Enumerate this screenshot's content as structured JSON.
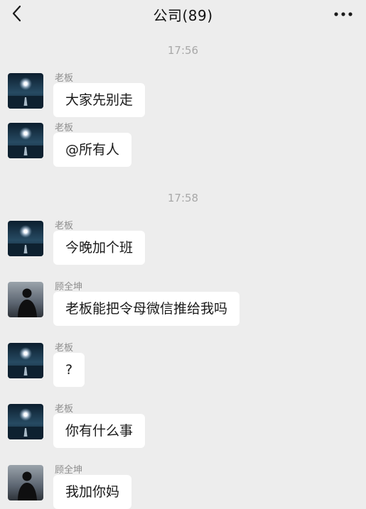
{
  "header": {
    "title": "公司(89)"
  },
  "timestamps": [
    "17:56",
    "17:58"
  ],
  "messages": [
    {
      "sender": "老板",
      "text": "大家先别走"
    },
    {
      "sender": "老板",
      "text": "@所有人"
    },
    {
      "sender": "老板",
      "text": "今晚加个班"
    },
    {
      "sender": "顾全坤",
      "text": "老板能把令母微信推给我吗"
    },
    {
      "sender": "老板",
      "text": "?"
    },
    {
      "sender": "老板",
      "text": "你有什么事"
    },
    {
      "sender": "顾全坤",
      "text": "我加你妈"
    }
  ],
  "icons": {
    "back": "chevron-left-icon",
    "more": "more-dots-icon",
    "boss_avatar": "moon-sea-avatar",
    "gu_avatar": "silhouette-avatar"
  },
  "colors": {
    "background": "#ededed",
    "bubble": "#ffffff",
    "timestamp": "#a8a8a8",
    "sender_name": "#8d8d8d"
  }
}
